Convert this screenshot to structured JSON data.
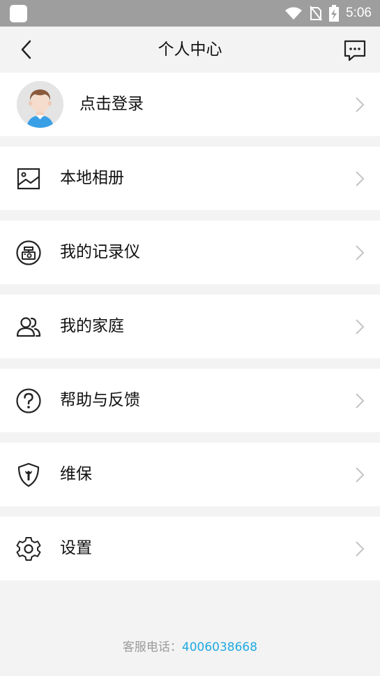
{
  "statusbar": {
    "time": "5:06"
  },
  "header": {
    "title": "个人中心"
  },
  "login": {
    "label": "点击登录"
  },
  "menu": [
    {
      "label": "本地相册",
      "icon": "album-icon"
    },
    {
      "label": "我的记录仪",
      "icon": "dashcam-icon"
    },
    {
      "label": "我的家庭",
      "icon": "family-icon"
    },
    {
      "label": "帮助与反馈",
      "icon": "help-icon"
    },
    {
      "label": "维保",
      "icon": "maintenance-icon"
    },
    {
      "label": "设置",
      "icon": "settings-icon"
    }
  ],
  "footer": {
    "label": "客服电话：",
    "phone": "4006038668"
  },
  "colors": {
    "accent": "#1fa9e0",
    "background": "#f3f3f3",
    "statusbar": "#9e9e9e"
  }
}
